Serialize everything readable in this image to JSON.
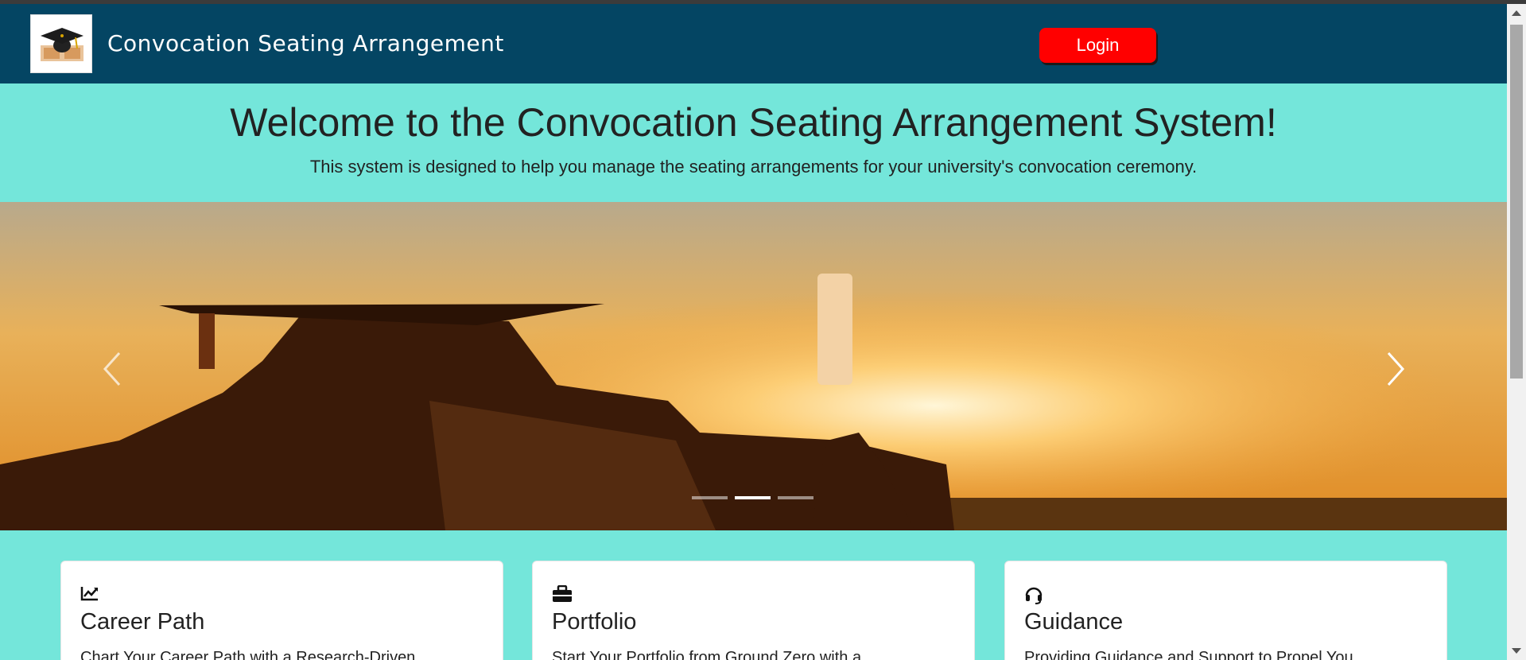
{
  "header": {
    "brand": "Convocation Seating Arrangement",
    "logo_icon": "graduation-cap-logo",
    "login_label": "Login",
    "colors": {
      "navbar": "#044563",
      "login": "#ff0000"
    }
  },
  "hero": {
    "title": "Welcome to the Convocation Seating Arrangement System!",
    "subtitle": "This system is designed to help you manage the seating arrangements for your university's convocation ceremony.",
    "background": "#74e6da"
  },
  "carousel": {
    "slide_count": 3,
    "active_index": 1,
    "prev_icon": "chevron-left-icon",
    "next_icon": "chevron-right-icon"
  },
  "cards": [
    {
      "icon": "chart-line-icon",
      "title": "Career Path",
      "text": "Chart Your Career Path with a Research-Driven"
    },
    {
      "icon": "briefcase-icon",
      "title": "Portfolio",
      "text": "Start Your Portfolio from Ground Zero with a"
    },
    {
      "icon": "headset-icon",
      "title": "Guidance",
      "text": "Providing Guidance and Support to Propel You"
    }
  ]
}
